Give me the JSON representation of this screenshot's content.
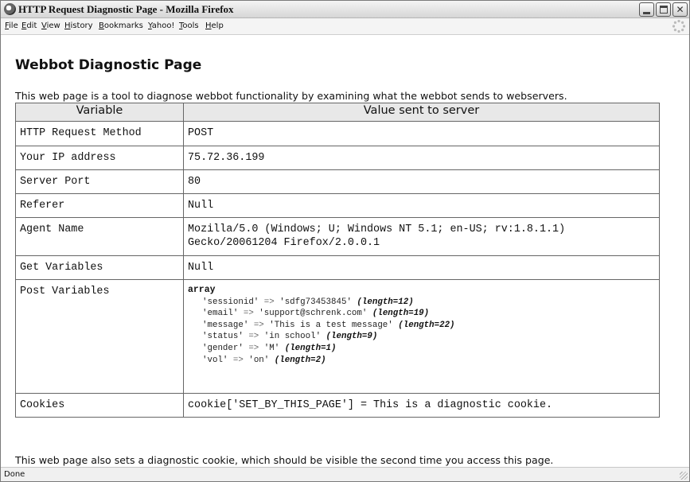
{
  "window": {
    "title": "HTTP Request Diagnostic Page - Mozilla Firefox",
    "minimize": "_",
    "close": "✕"
  },
  "menu": [
    "File",
    "Edit",
    "View",
    "History",
    "Bookmarks",
    "Yahoo!",
    "Tools",
    "Help"
  ],
  "page": {
    "heading": "Webbot Diagnostic Page",
    "intro": "This web page is a tool to diagnose webbot functionality by examining what the webbot sends to webservers.",
    "outro": "This web page also sets a diagnostic cookie, which should be visible the second time you access this page."
  },
  "table": {
    "headers": [
      "Variable",
      "Value sent to server"
    ],
    "rows": [
      {
        "variable": "HTTP Request Method",
        "value": "POST"
      },
      {
        "variable": "Your IP address",
        "value": "75.72.36.199"
      },
      {
        "variable": "Server Port",
        "value": "80"
      },
      {
        "variable": "Referer",
        "value": "Null"
      },
      {
        "variable": "Agent Name",
        "value_lines": [
          "Mozilla/5.0 (Windows; U; Windows NT 5.1; en-US; rv:1.8.1.1)",
          "Gecko/20061204 Firefox/2.0.0.1"
        ]
      },
      {
        "variable": "Get Variables",
        "value": "Null"
      },
      {
        "variable": "Post Variables",
        "array_label": "array",
        "entries": [
          {
            "key": "'sessionid'",
            "arrow": "=>",
            "val": "'sdfg73453845'",
            "len": "(length=12)"
          },
          {
            "key": "'email'",
            "arrow": "=>",
            "val": "'support@schrenk.com'",
            "len": "(length=19)"
          },
          {
            "key": "'message'",
            "arrow": "=>",
            "val": "'This is a test message'",
            "len": "(length=22)"
          },
          {
            "key": "'status'",
            "arrow": "=>",
            "val": "'in school'",
            "len": "(length=9)"
          },
          {
            "key": "'gender'",
            "arrow": "=>",
            "val": "'M'",
            "len": "(length=1)"
          },
          {
            "key": "'vol'",
            "arrow": "=>",
            "val": "'on'",
            "len": "(length=2)"
          }
        ]
      },
      {
        "variable": "Cookies",
        "value": "cookie['SET_BY_THIS_PAGE'] = This is a diagnostic cookie."
      }
    ]
  },
  "status": "Done",
  "icons": [
    "firefox-icon",
    "minimize-icon",
    "maximize-icon",
    "close-icon",
    "throbber-icon",
    "resize-grip-icon"
  ]
}
